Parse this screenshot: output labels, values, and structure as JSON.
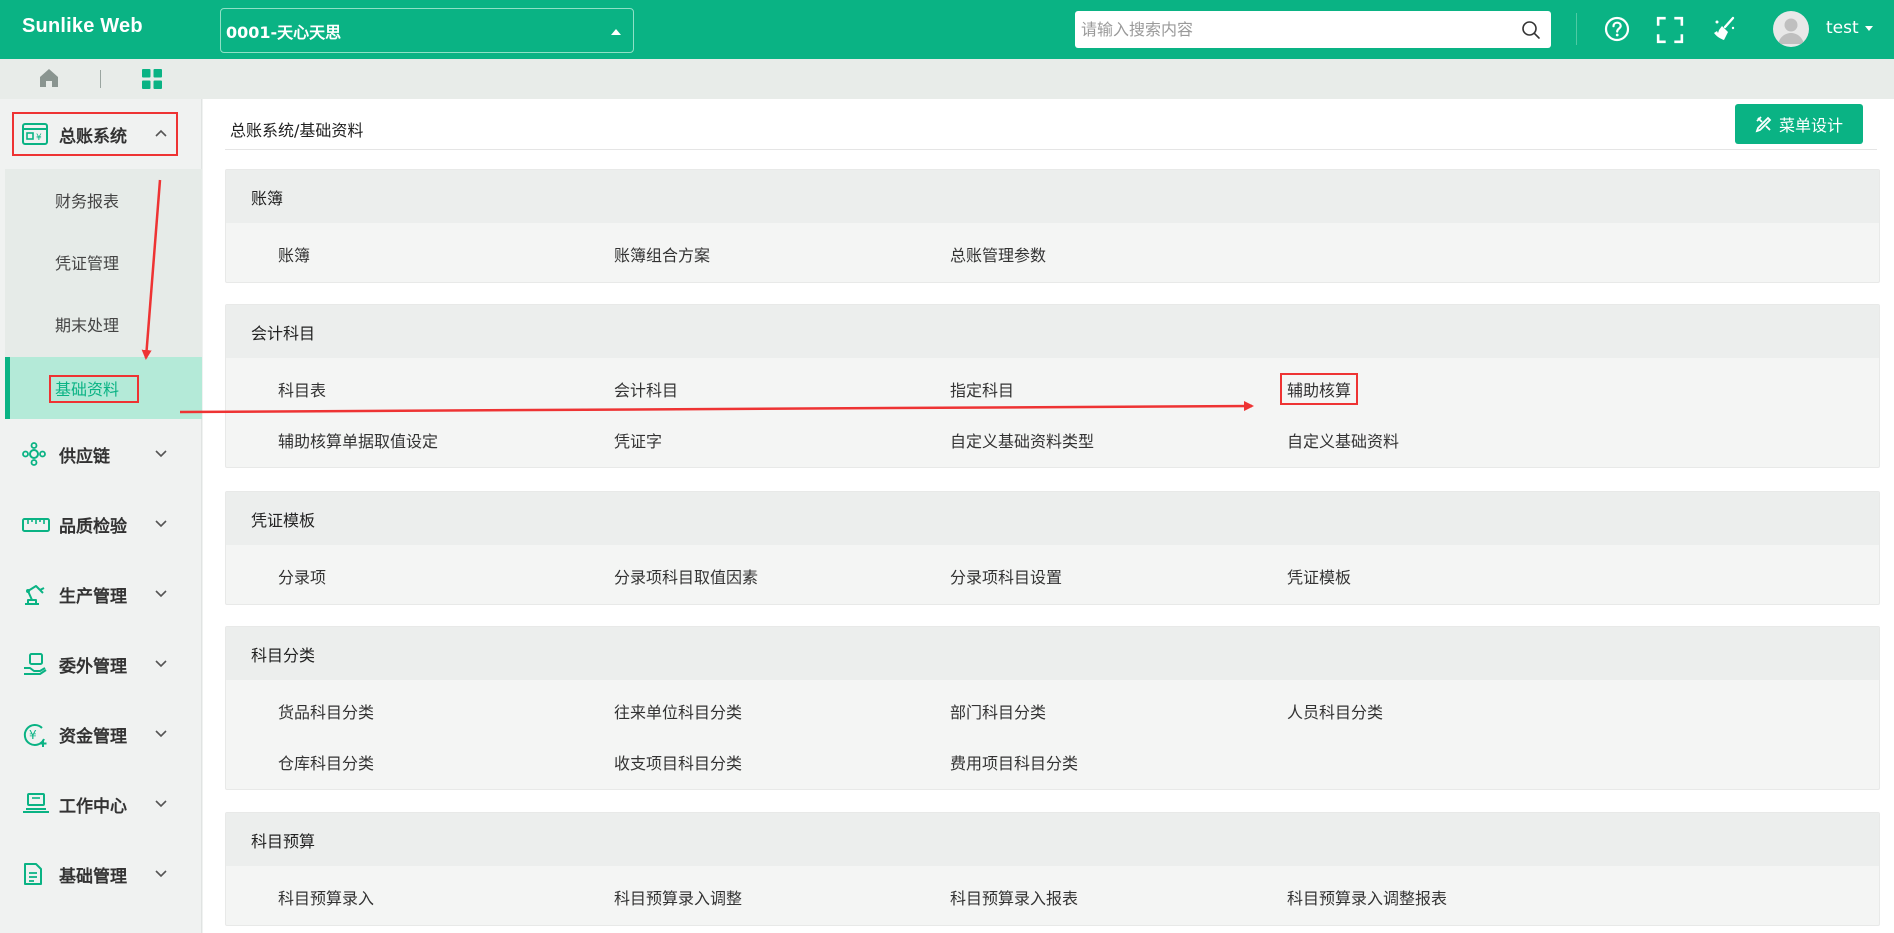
{
  "header": {
    "brand": "Sunlike Web",
    "company": "0001-天心天思",
    "search_placeholder": "请输入搜索内容",
    "user": "test",
    "accent": "#0ab384"
  },
  "subbar": {
    "icons": [
      "home-icon",
      "grid-icon"
    ]
  },
  "sidebar": {
    "modules": [
      {
        "label": "总账系统",
        "icon": "ledger-icon",
        "expanded": true
      },
      {
        "label": "供应链",
        "icon": "supply-chain-icon"
      },
      {
        "label": "品质检验",
        "icon": "ruler-icon"
      },
      {
        "label": "生产管理",
        "icon": "robot-arm-icon"
      },
      {
        "label": "委外管理",
        "icon": "outsourcing-icon"
      },
      {
        "label": "资金管理",
        "icon": "money-icon"
      },
      {
        "label": "工作中心",
        "icon": "workstation-icon"
      },
      {
        "label": "基础管理",
        "icon": "document-icon"
      }
    ],
    "sub_items": [
      "财务报表",
      "凭证管理",
      "期末处理",
      "基础资料"
    ],
    "active_sub": "基础资料"
  },
  "main": {
    "breadcrumb": "总账系统/基础资料",
    "design_button": "菜单设计",
    "sections": [
      {
        "title": "账簿",
        "items": [
          "账簿",
          "账簿组合方案",
          "总账管理参数"
        ]
      },
      {
        "title": "会计科目",
        "items": [
          "科目表",
          "会计科目",
          "指定科目",
          "辅助核算",
          "辅助核算单据取值设定",
          "凭证字",
          "自定义基础资料类型",
          "自定义基础资料"
        ]
      },
      {
        "title": "凭证模板",
        "items": [
          "分录项",
          "分录项科目取值因素",
          "分录项科目设置",
          "凭证模板"
        ]
      },
      {
        "title": "科目分类",
        "items": [
          "货品科目分类",
          "往来单位科目分类",
          "部门科目分类",
          "人员科目分类",
          "仓库科目分类",
          "收支项目科目分类",
          "费用项目科目分类"
        ]
      },
      {
        "title": "科目预算",
        "items": [
          "科目预算录入",
          "科目预算录入调整",
          "科目预算录入报表",
          "科目预算录入调整报表"
        ]
      }
    ]
  }
}
